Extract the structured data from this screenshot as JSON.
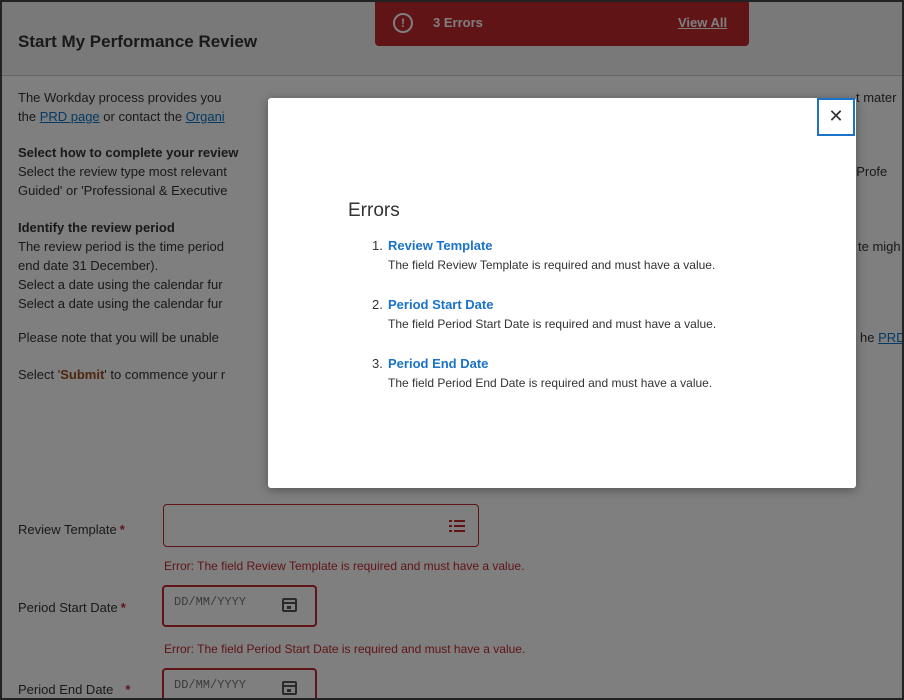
{
  "header": {
    "title": "Start My Performance Review",
    "banner": {
      "count_text": "3 Errors",
      "view_all": "View All",
      "alert_glyph": "!"
    }
  },
  "body": {
    "intro_line1": "The Workday process provides you",
    "intro_line1_right": "t mater",
    "intro_line2_pre": "the ",
    "intro_line2_link1": "PRD page",
    "intro_line2_mid": " or contact the ",
    "intro_line2_link2": "Organi",
    "section1_title": "Select how to complete your review",
    "section1_line1": "Select the review type most relevant",
    "section1_line1_right": "ct 'Profe",
    "section1_line2": "Guided' or 'Professional & Executive",
    "section2_title": "Identify the review period",
    "section2_line1": "The review period is the time period",
    "section2_line1_right": "te migh",
    "section2_line2": "end date 31 December).",
    "section2_line3": "Select a date using the calendar fur",
    "section2_line4": "Select a date using the calendar fur",
    "note_line": "Please note that you will be unable",
    "note_right_pre": "he ",
    "note_right_link": "PRD",
    "submit_pre": "Select '",
    "submit_word": "Submit",
    "submit_post": "' to commence your r"
  },
  "form": {
    "review_template": {
      "label": "Review Template",
      "error_prefix": "Error:",
      "error_text": " The field Review Template is required and must have a value."
    },
    "period_start": {
      "label": "Period Start Date",
      "placeholder": "DD/MM/YYYY",
      "error_prefix": "Error:",
      "error_text": " The field Period Start Date is required and must have a value."
    },
    "period_end": {
      "label": "Period End Date",
      "placeholder": "DD/MM/YYYY"
    },
    "required_mark": "*"
  },
  "modal": {
    "close_glyph": "✕",
    "title": "Errors",
    "errors": [
      {
        "num": "1.",
        "field": "Review Template",
        "message": "The field Review Template is required and must have a value."
      },
      {
        "num": "2.",
        "field": "Period Start Date",
        "message": "The field Period Start Date is required and must have a value."
      },
      {
        "num": "3.",
        "field": "Period End Date",
        "message": "The field Period End Date is required and must have a value."
      }
    ]
  },
  "colors": {
    "error_red": "#c0282d",
    "link_blue": "#1a73c8",
    "submit_brown": "#9c4b1a"
  }
}
